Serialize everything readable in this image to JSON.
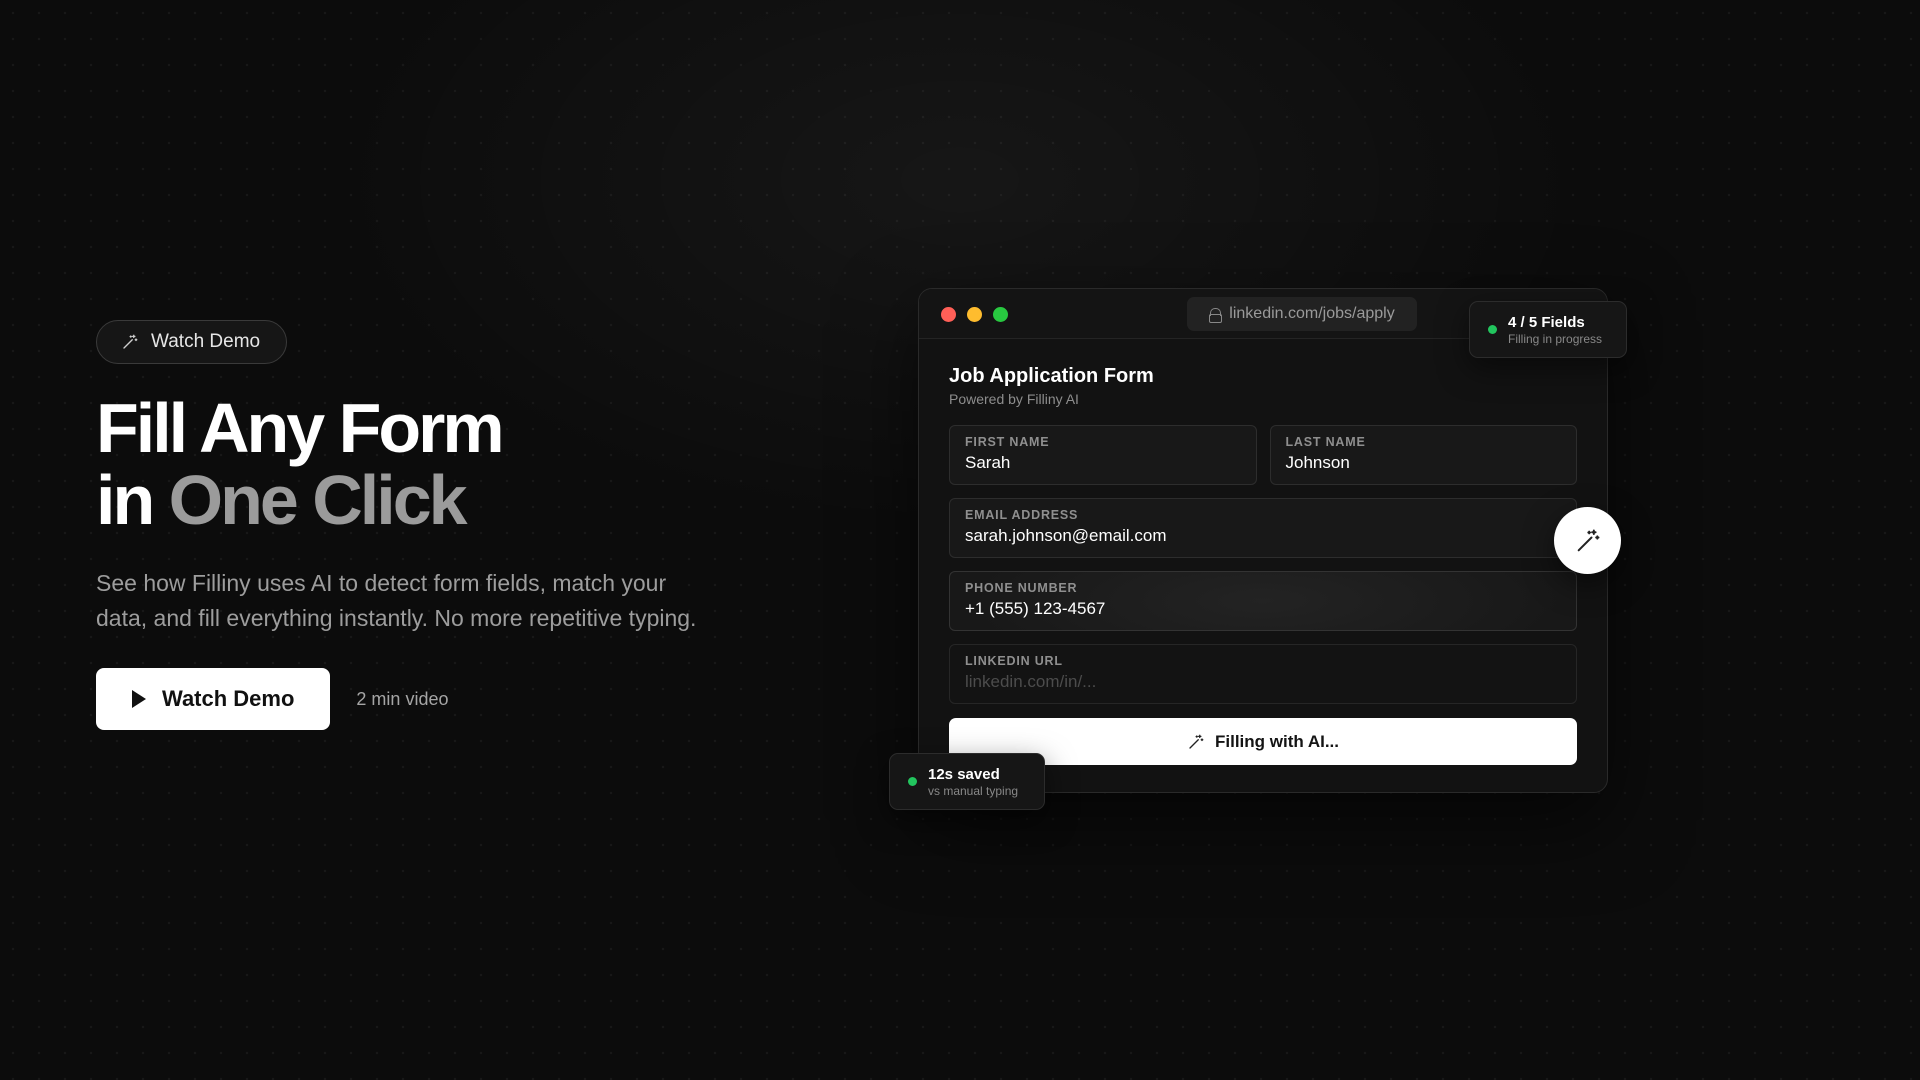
{
  "hero": {
    "pill_label": "Watch Demo",
    "pill_icon": "magic-wand-icon",
    "title_line1": "Fill Any Form",
    "title_line2_prefix": "in ",
    "title_line2_highlight": "One Click",
    "description": "See how Filliny uses AI to detect form fields, match your data, and fill everything instantly. No more repetitive typing.",
    "cta_label": "Watch Demo",
    "cta_icon": "play-icon",
    "cta_note": "2 min video"
  },
  "browser": {
    "url": "linkedin.com/jobs/apply",
    "window_dots": [
      "#ff5f57",
      "#febc2e",
      "#28c840"
    ],
    "form_title": "Job Application Form",
    "form_subtitle": "Powered by Filliny AI",
    "fields": {
      "first_name": {
        "label": "FIRST NAME",
        "value": "Sarah"
      },
      "last_name": {
        "label": "LAST NAME",
        "value": "Johnson"
      },
      "email": {
        "label": "EMAIL ADDRESS",
        "value": "sarah.johnson@email.com"
      },
      "phone": {
        "label": "PHONE NUMBER",
        "value": "+1 (555) 123-4567"
      },
      "linkedin": {
        "label": "LINKEDIN URL",
        "placeholder": "linkedin.com/in/..."
      }
    },
    "fill_button_label": "Filling with AI..."
  },
  "badges": {
    "fields": {
      "title": "4 / 5 Fields",
      "subtitle": "Filling in progress"
    },
    "saved": {
      "title": "12s saved",
      "subtitle": "vs manual typing"
    },
    "status_color": "#22c55e"
  },
  "colors": {
    "background": "#0c0c0c",
    "accent": "#ffffff",
    "muted_text": "#9b9b9b"
  }
}
